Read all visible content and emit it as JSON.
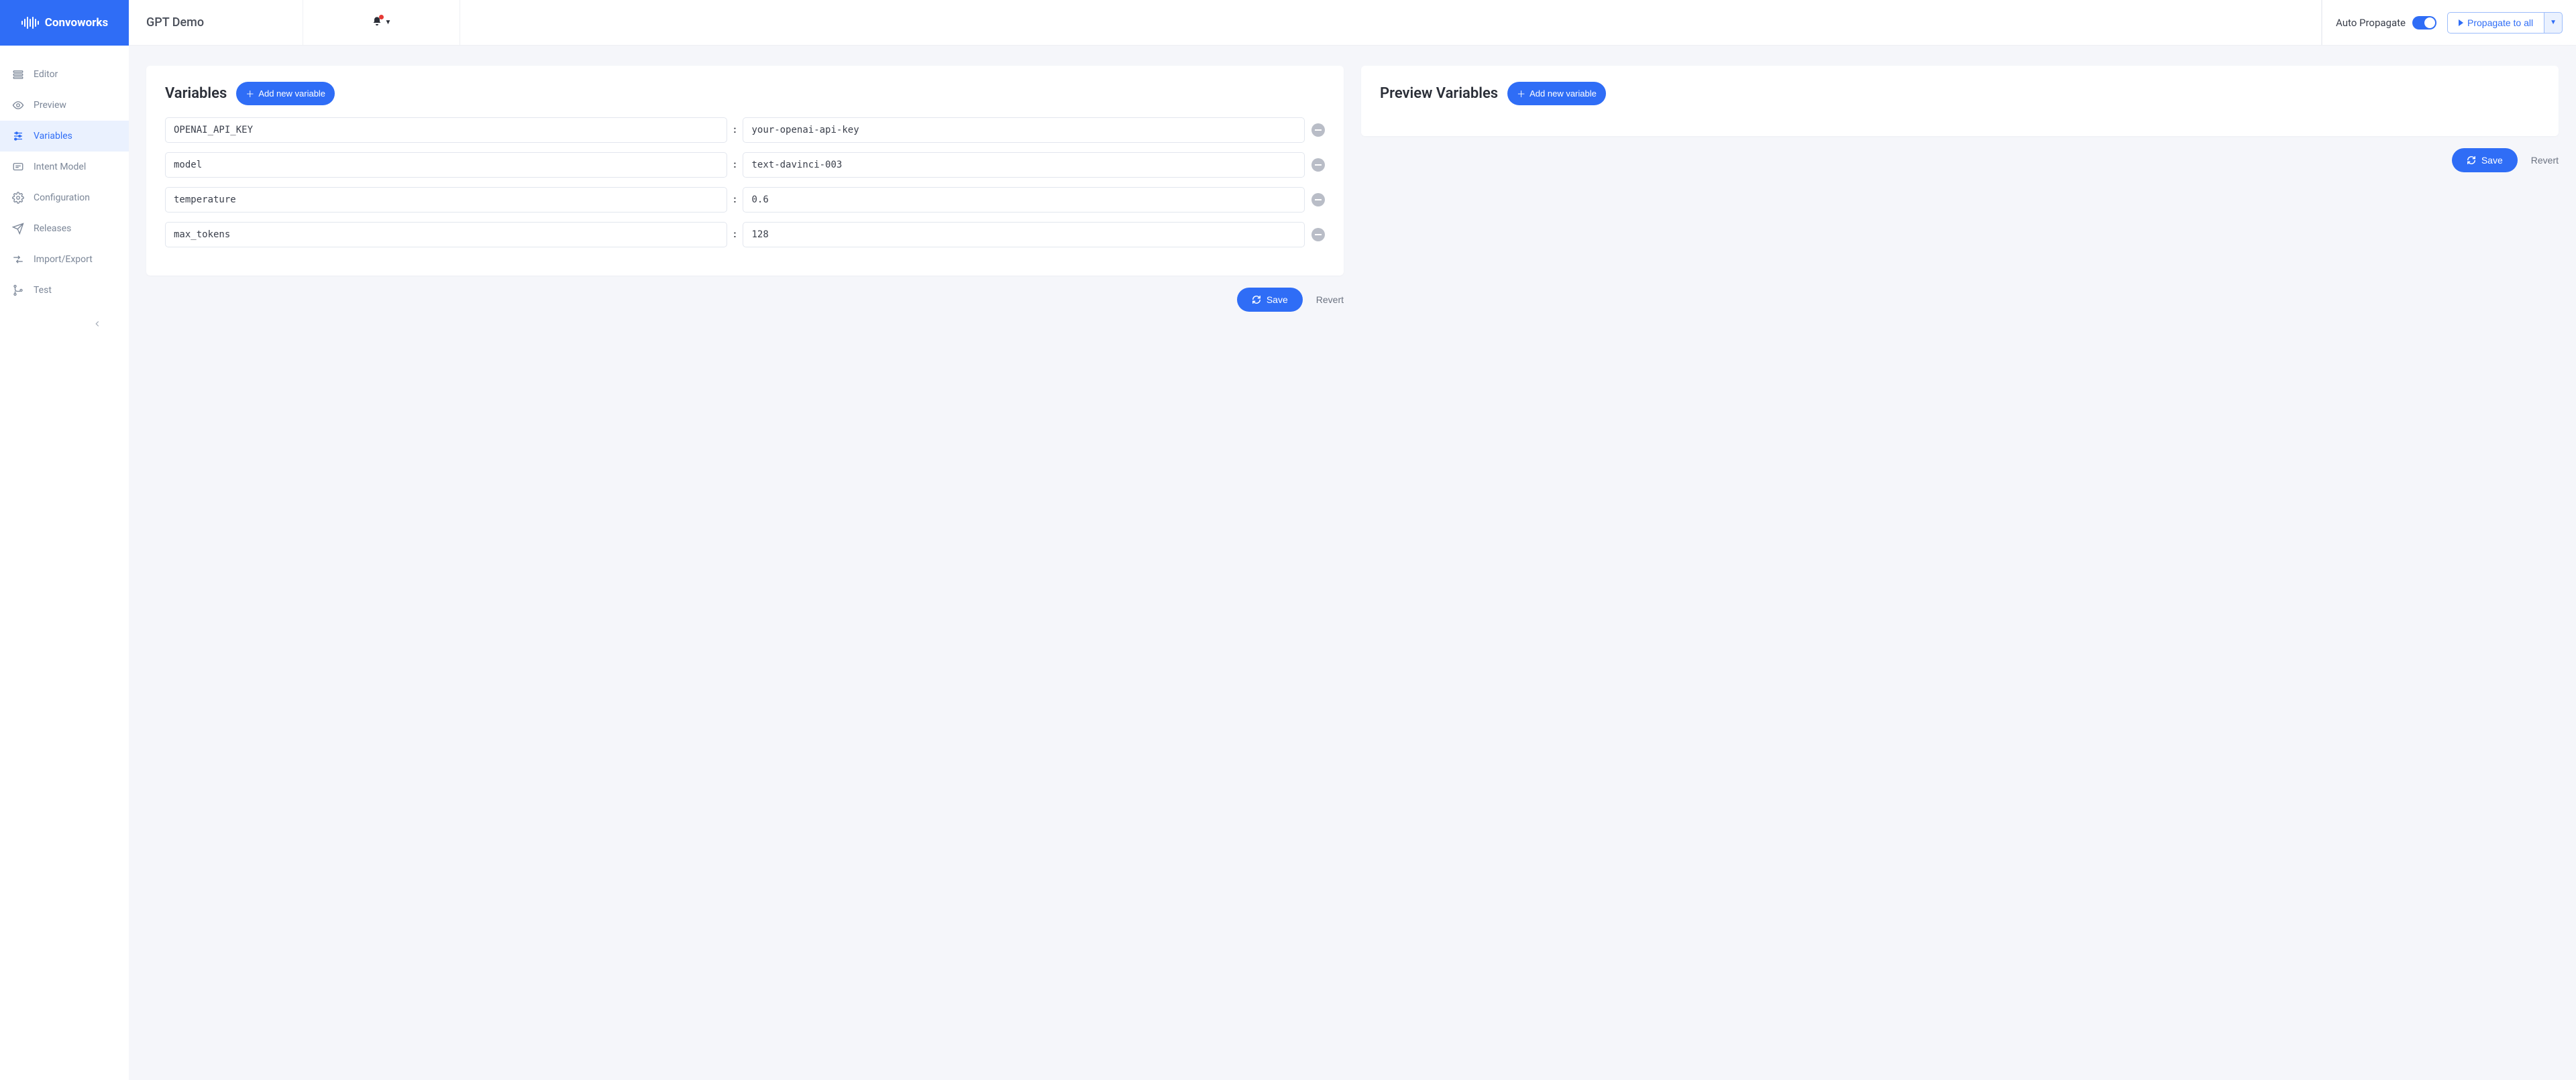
{
  "brand": {
    "name": "Convoworks"
  },
  "service_title": "GPT Demo",
  "auto_propagate": {
    "label": "Auto Propagate",
    "on": true
  },
  "propagate_button": "Propagate to all",
  "sidebar": {
    "items": [
      {
        "label": "Editor",
        "icon": "editor-icon"
      },
      {
        "label": "Preview",
        "icon": "preview-icon"
      },
      {
        "label": "Variables",
        "icon": "variables-icon",
        "active": true
      },
      {
        "label": "Intent Model",
        "icon": "intent-model-icon"
      },
      {
        "label": "Configuration",
        "icon": "configuration-icon"
      },
      {
        "label": "Releases",
        "icon": "releases-icon"
      },
      {
        "label": "Import/Export",
        "icon": "import-export-icon"
      },
      {
        "label": "Test",
        "icon": "test-icon"
      }
    ]
  },
  "variables_panel": {
    "title": "Variables",
    "add_label": "Add new variable",
    "rows": [
      {
        "key": "OPENAI_API_KEY",
        "value": "your-openai-api-key"
      },
      {
        "key": "model",
        "value": "text-davinci-003"
      },
      {
        "key": "temperature",
        "value": "0.6"
      },
      {
        "key": "max_tokens",
        "value": "128"
      }
    ],
    "save_label": "Save",
    "revert_label": "Revert"
  },
  "preview_panel": {
    "title": "Preview Variables",
    "add_label": "Add new variable",
    "save_label": "Save",
    "revert_label": "Revert"
  }
}
